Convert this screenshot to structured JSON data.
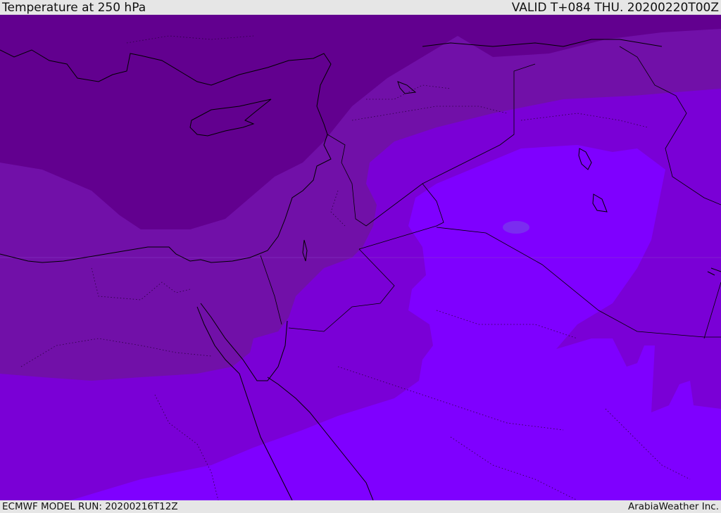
{
  "header": {
    "title": "Temperature at 250 hPa",
    "valid_time": "VALID T+084 THU. 20200220T00Z"
  },
  "footer": {
    "model_run": "ECMWF MODEL RUN: 20200216T12Z",
    "credit": "ArabiaWeather Inc."
  },
  "colors": {
    "band_coldest": "#62008f",
    "band_cold": "#7110a8",
    "band_mid": "#7a00d6",
    "band_warm": "#7f00ff",
    "warm_spot": "#7a2cf0",
    "coastline": "#000000"
  }
}
